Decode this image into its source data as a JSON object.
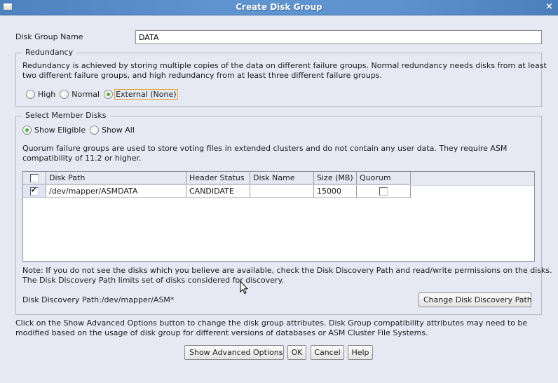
{
  "window": {
    "title": "Create Disk Group",
    "close_icon": "×"
  },
  "disk_group_name": {
    "label": "Disk Group Name",
    "value": "DATA"
  },
  "redundancy": {
    "title": "Redundancy",
    "description_line1": "Redundancy is achieved by storing multiple copies of the data on different failure groups. Normal redundancy needs disks from at least",
    "description_line2": "two different failure groups, and high redundancy from at least three different failure groups.",
    "options": [
      {
        "label": "High",
        "selected": false
      },
      {
        "label": "Normal",
        "selected": false
      },
      {
        "label": "External (None)",
        "selected": true
      }
    ]
  },
  "member_disks": {
    "title": "Select Member Disks",
    "filter_options": [
      {
        "label": "Show Eligible",
        "selected": true
      },
      {
        "label": "Show All",
        "selected": false
      }
    ],
    "quorum_note_line1": "Quorum failure groups are used to store voting files in extended clusters and do not contain any user data. They require ASM",
    "quorum_note_line2": "compatibility of 11.2 or higher.",
    "table": {
      "select_all_checked": false,
      "columns": [
        "Disk Path",
        "Header Status",
        "Disk Name",
        "Size (MB)",
        "Quorum"
      ],
      "rows": [
        {
          "selected": true,
          "disk_path": "/dev/mapper/ASMDATA",
          "header_status": "CANDIDATE",
          "disk_name": "",
          "size_mb": "15000",
          "quorum": false
        }
      ]
    },
    "note_line1": "Note: If you do not see the disks which you believe are available, check the Disk Discovery Path and read/write permissions on the disks.",
    "note_line2": "The Disk Discovery Path limits set of disks considered for discovery.",
    "discovery_path_label": "Disk Discovery Path:/dev/mapper/ASM*",
    "change_path_button": "Change Disk Discovery Path"
  },
  "advanced_note_line1": "Click on the Show Advanced Options button to change the disk group attributes. Disk Group compatibility attributes may need to be",
  "advanced_note_line2": "modified based on the usage of disk group for different versions of databases or ASM Cluster File Systems.",
  "buttons": {
    "show_advanced": "Show Advanced Options",
    "ok": "OK",
    "cancel": "Cancel",
    "help": "Help"
  }
}
